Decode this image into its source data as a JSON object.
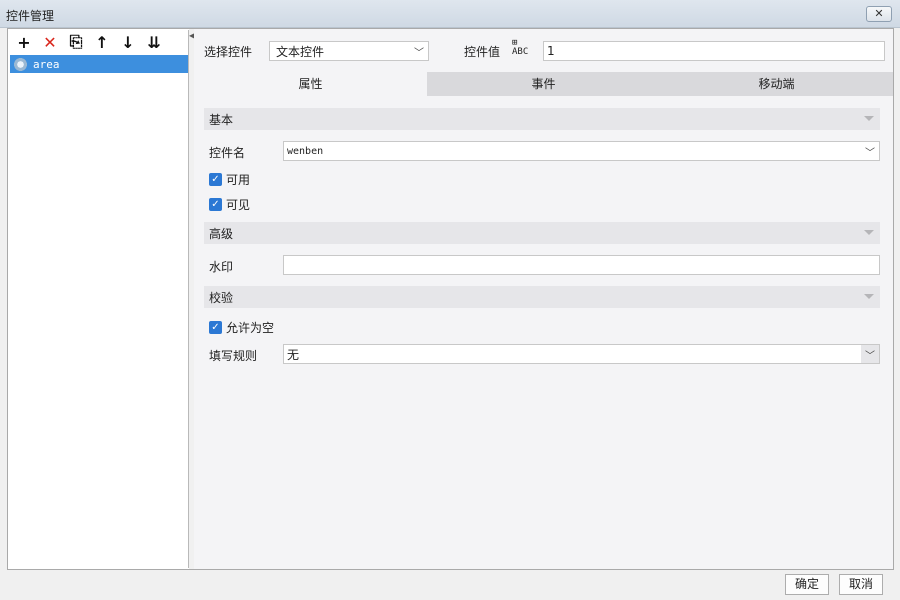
{
  "window": {
    "title": "控件管理",
    "close_label": "✕"
  },
  "toolbar": {
    "icons": [
      "add-icon",
      "delete-icon",
      "copy-icon",
      "move-up-icon",
      "move-down-icon",
      "sort-icon"
    ],
    "add_glyph": "+",
    "delete_glyph": "✕",
    "copy_glyph": "⎘",
    "up_glyph": "↑",
    "down_glyph": "↓",
    "sort_glyph": "⇊"
  },
  "tree": {
    "items": [
      {
        "label": "area",
        "icon": "gear-icon",
        "selected": true
      }
    ]
  },
  "header": {
    "select_label": "选择控件",
    "select_value": "文本控件",
    "value_label": "控件值",
    "value_input": "1"
  },
  "tabs": [
    "属性",
    "事件",
    "移动端"
  ],
  "sections": {
    "basic": {
      "title": "基本",
      "name_label": "控件名",
      "name_value": "wenben",
      "enabled_label": "可用",
      "visible_label": "可见"
    },
    "advanced": {
      "title": "高级",
      "watermark_label": "水印",
      "watermark_value": ""
    },
    "validation": {
      "title": "校验",
      "allow_empty_label": "允许为空",
      "rule_label": "填写规则",
      "rule_value": "无"
    }
  },
  "footer": {
    "ok_label": "确定",
    "cancel_label": "取消"
  },
  "colors": {
    "selection": "#3d8fde",
    "checkbox": "#2b78d4",
    "delete": "#d9261c"
  }
}
